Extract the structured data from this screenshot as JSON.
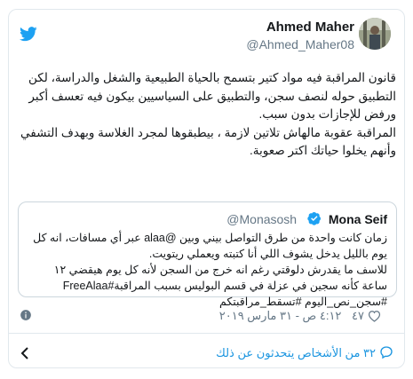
{
  "tweet": {
    "author_name": "Ahmed Maher",
    "author_handle": "@Ahmed_Maher08",
    "text_lines": [
      "قانون المراقبة فيه مواد كتير بتسمح بالحياة الطبيعية والشغل والدراسة، لكن التطبيق حوله لنصف سجن، والتطبيق على السياسيين بيكون فيه تعسف أكبر ورفض للإجازات بدون سبب.",
      "المراقبة عقوبة مالهاش تلاتين لازمة ، بيطبقوها لمجرد الغلاسة وبهدف التشفي وأنهم يخلوا حياتك اكتر صعوبة."
    ],
    "likes": "٤٧",
    "timestamp": "٤:١٢ ص - ٣١ مارس ٢٠١٩",
    "replies_text": "٣٢ من الأشخاص يتحدثون عن ذلك"
  },
  "quoted_tweet": {
    "author_name": "Mona Seif",
    "author_handle": "@Monasosh",
    "text_lines": [
      "زمان كانت واحدة من طرق التواصل بيني وبين @alaa عبر أي مسافات، انه كل يوم بالليل يدخل يشوف اللي أنا كتبته ويعملي ريتويت.",
      "للاسف ما يقدرش دلوقتي رغم انه خرج من السجن لأنه كل يوم هيقضي ١٢ ساعة كأنه سجين في عزلة في قسم البوليس بسبب المراقبة#FreeAlaa #سجن_نص_اليوم #تسقط_مراقبتكم"
    ]
  },
  "colors": {
    "twitter_blue": "#1da1f2",
    "link_blue": "#1b95e0",
    "muted": "#657786",
    "text": "#14171a",
    "border": "#e1e8ed"
  },
  "icons": {
    "brand": "twitter-bird-icon",
    "verified": "verified-badge-icon",
    "like": "heart-icon",
    "info": "info-icon",
    "reply": "reply-bubble-icon",
    "nav": "chevron-left-icon"
  }
}
